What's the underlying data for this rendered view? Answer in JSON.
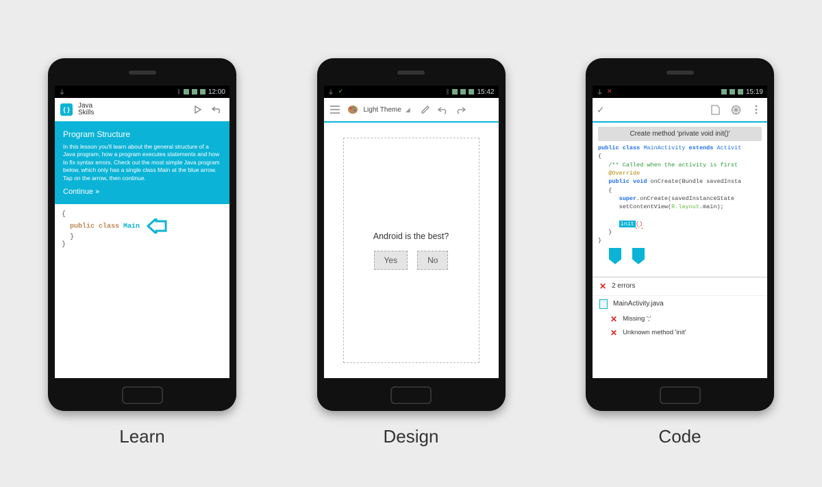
{
  "captions": {
    "learn": "Learn",
    "design": "Design",
    "code": "Code"
  },
  "phone1": {
    "status_time": "12:00",
    "app_title_line1": "Java",
    "app_title_line2": "Skills",
    "hero_title": "Program Structure",
    "hero_body": "In this lesson you'll learn about the general structure of a Java program, how a program executes statements and how to fix syntax errors. Check out the most simple Java program below, which only has a single class Main at the blue arrow. Tap on the arrow, then continue.",
    "continue": "Continue »",
    "code_kw": "public class",
    "code_cls": "Main"
  },
  "phone2": {
    "status_time": "15:42",
    "toolbar_title": "Light Theme",
    "prompt": "Android is the best?",
    "btn_yes": "Yes",
    "btn_no": "No"
  },
  "phone3": {
    "status_time": "15:19",
    "tooltip": "Create method 'private void init()'",
    "code": {
      "l1a": "public class",
      "l1b": "MainActivity",
      "l1c": "extends",
      "l1d": "Activit",
      "l3": "/** Called when the activity is first",
      "l4": "@Override",
      "l5a": "public void",
      "l5b": "onCreate(Bundle savedInsta",
      "l7a": "super",
      "l7b": ".onCreate(savedInstanceState",
      "l8a": "setContentView(",
      "l8b": "R.layout",
      "l8c": ".main);",
      "l10": "init",
      "l10b": "()"
    },
    "errors_header": "2 errors",
    "file": "MainActivity.java",
    "err1": "Missing ';'",
    "err2": "Unknown method 'init'"
  }
}
